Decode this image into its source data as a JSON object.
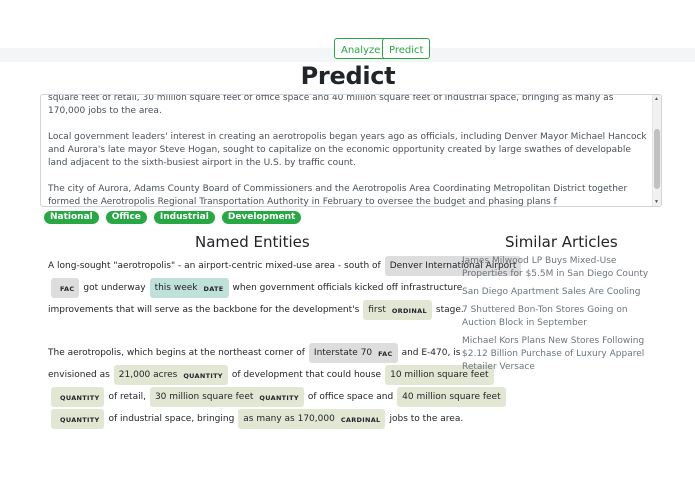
{
  "nav": {
    "analyze_label": "Analyze",
    "predict_label": "Predict"
  },
  "page_title": "Predict",
  "article": {
    "paragraphs": [
      "square feet of retail, 30 million square feet of office space and 40 million square feet of industrial space, bringing as many as 170,000 jobs to the area.",
      "Local government leaders' interest in creating an aerotropolis began years ago as officials, including Denver Mayor Michael Hancock and Aurora's late mayor Steve Hogan, sought to capitalize on the economic opportunity created by large swathes of developable land adjacent to the sixth-busiest airport in the U.S. by traffic count.",
      "The city of Aurora, Adams County Board of Commissioners and the Aerotropolis Area Coordinating Metropolitan District together formed the Aerotropolis Regional Transportation Authority in February to oversee the budget and phasing plans f"
    ]
  },
  "tags": [
    "National",
    "Office",
    "Industrial",
    "Development"
  ],
  "named_entities": {
    "heading": "Named Entities",
    "p1": {
      "t1": "A long-sought \"aerotropolis\" - an airport-centric mixed-use area - south of",
      "e1": "Denver International Airport",
      "e1_label": "FAC",
      "t2": "got underway",
      "e2": "this week",
      "e2_label": "DATE",
      "t3": "when government officials kicked off infrastructure",
      "t4": "improvements that will serve as the backbone for the development's",
      "e3": "first",
      "e3_label": "ORDINAL",
      "t5": "stage."
    },
    "p2": {
      "t1": "The aerotropolis, which begins at the northeast corner of",
      "e1": "Interstate 70",
      "e1_label": "FAC",
      "t2": "and E-470, is",
      "t3": "envisioned as",
      "e2": "21,000 acres",
      "e2_label": "QUANTITY",
      "t4": "of development that could house",
      "e3": "10 million square feet",
      "e3_label": "QUANTITY",
      "t5": "of retail,",
      "e4": "30 million square feet",
      "e4_label": "QUANTITY",
      "t6": "of office space and",
      "e5": "40 million square feet",
      "e5_label": "QUANTITY",
      "t7": "of industrial space, bringing",
      "e6": "as many as 170,000",
      "e6_label": "CARDINAL",
      "t8": "jobs to the area."
    }
  },
  "similar_articles": {
    "heading": "Similar Articles",
    "items": [
      "James Milwood LP Buys Mixed-Use Properties for $5.5M in San Diego County",
      "San Diego Apartment Sales Are Cooling",
      "7 Shuttered Bon-Ton Stores Going on Auction Block in September",
      "Michael Kors Plans New Stores Following $2.12 Billion Purchase of Luxury Apparel Retailer Versace"
    ]
  }
}
